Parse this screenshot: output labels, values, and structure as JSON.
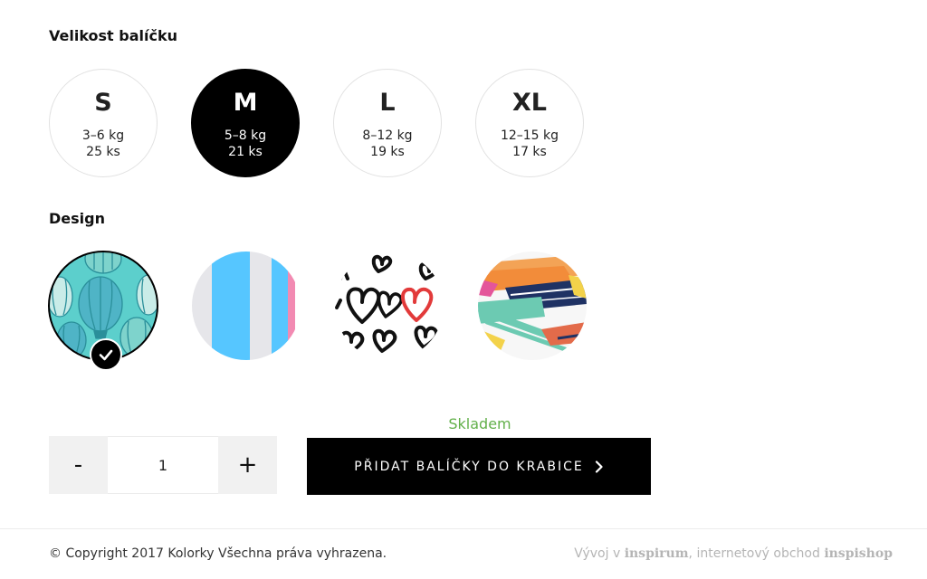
{
  "size_section": {
    "title": "Velikost balíčku",
    "options": [
      {
        "letter": "S",
        "weight": "3–6 kg",
        "count": "25 ks"
      },
      {
        "letter": "M",
        "weight": "5–8 kg",
        "count": "21 ks"
      },
      {
        "letter": "L",
        "weight": "8–12 kg",
        "count": "19 ks"
      },
      {
        "letter": "XL",
        "weight": "12–15 kg",
        "count": "17 ks"
      }
    ],
    "selected": "M"
  },
  "design_section": {
    "title": "Design",
    "options": [
      {
        "icon": "hot-air-balloons-pattern",
        "selected": true
      },
      {
        "icon": "vertical-stripes-pattern",
        "selected": false
      },
      {
        "icon": "hearts-pattern",
        "selected": false
      },
      {
        "icon": "paint-strokes-pattern",
        "selected": false
      }
    ]
  },
  "stock_status": "Skladem",
  "quantity": {
    "minus_label": "-",
    "value": "1",
    "plus_label": "+"
  },
  "add_button": {
    "label": "PŘIDAT BALÍČKY DO KRABICE"
  },
  "footer": {
    "copyright": "© Copyright 2017  Kolorky  Všechna práva vyhrazena.",
    "credit_prefix": "Vývoj v ",
    "credit_brand1": "inspirum",
    "credit_mid": ", internetový obchod ",
    "credit_brand2": "inspishop"
  },
  "colors": {
    "accent": "#000000",
    "stock": "#62b04a",
    "qty_bg": "#f1f1f1"
  }
}
